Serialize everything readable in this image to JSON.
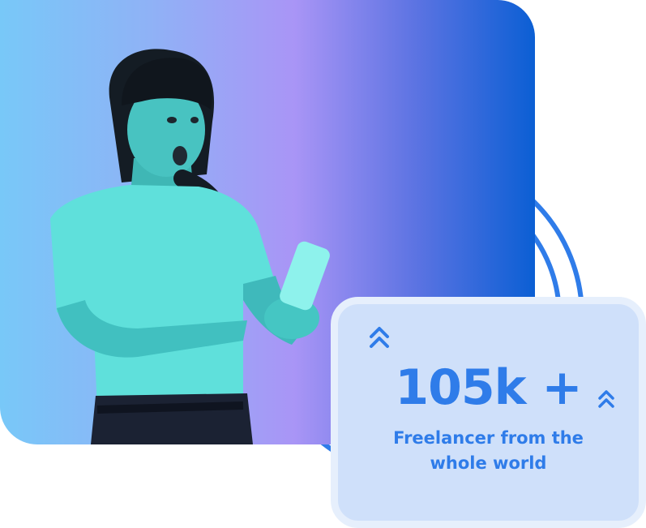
{
  "colors": {
    "accent": "#2f7ce9",
    "card_background": "#cfe0fa",
    "card_border": "#e6effc",
    "photo_gradient_start": "#78c8f8",
    "photo_gradient_mid": "#a995f6",
    "photo_gradient_end": "#0b5fd4"
  },
  "stat_card": {
    "value": "105k +",
    "caption": "Freelancer from the whole world",
    "icons": [
      "double-chevron-up-icon",
      "double-chevron-up-icon"
    ]
  }
}
